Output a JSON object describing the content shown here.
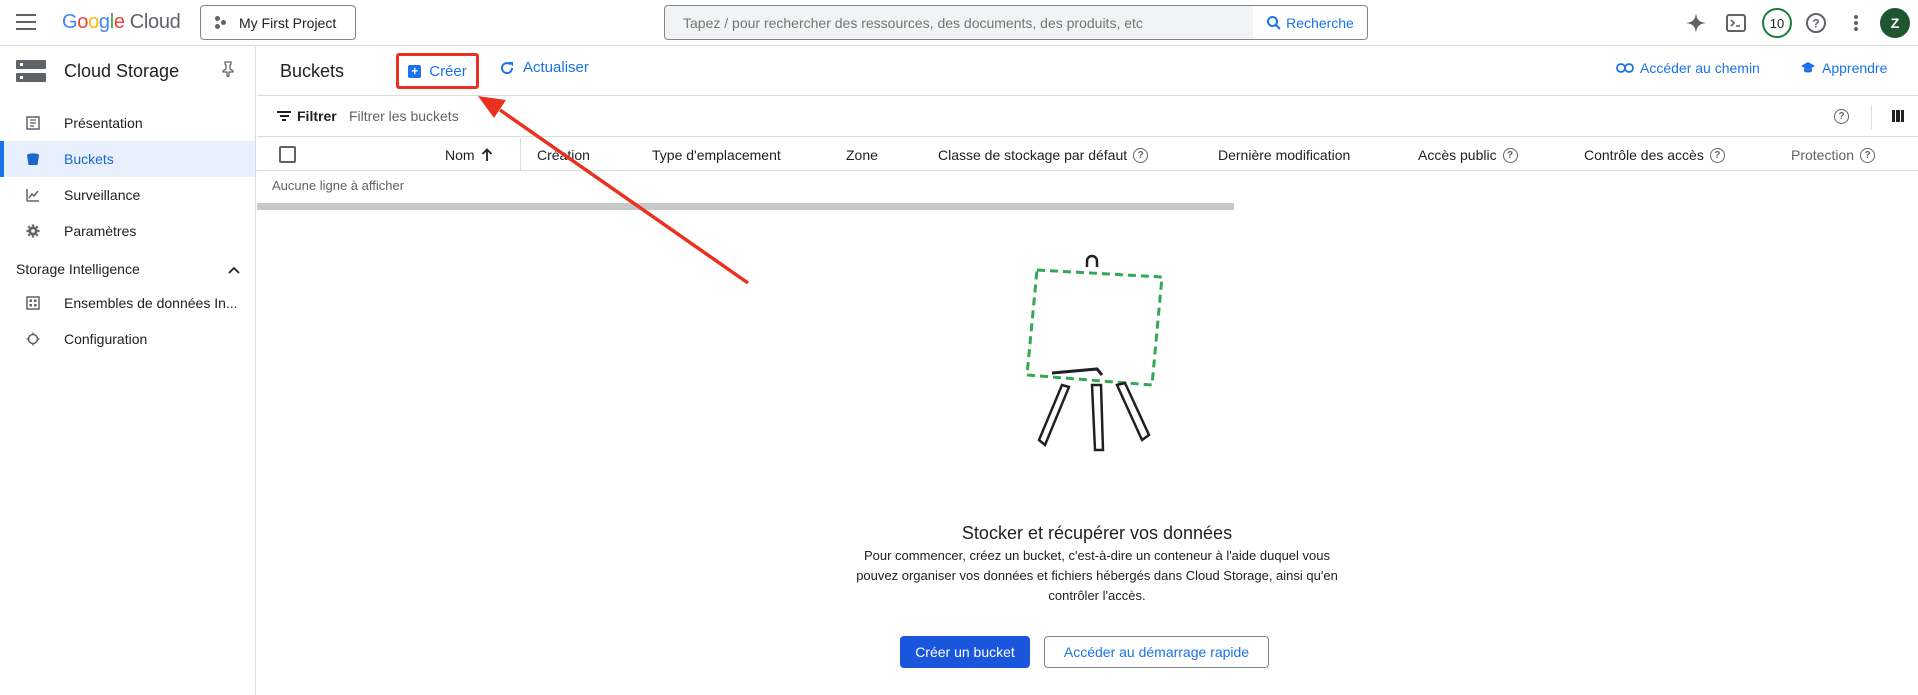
{
  "topbar": {
    "logo_google": "Google",
    "logo_cloud": "Cloud",
    "project": "My First Project",
    "search_placeholder": "Tapez / pour rechercher des ressources, des documents, des produits, etc",
    "search_button": "Recherche",
    "notifications_count": "10",
    "avatar_letter": "Z"
  },
  "sidebar": {
    "title": "Cloud Storage",
    "items": [
      {
        "label": "Présentation",
        "icon": "dashboard-icon"
      },
      {
        "label": "Buckets",
        "icon": "bucket-icon"
      },
      {
        "label": "Surveillance",
        "icon": "chart-icon"
      },
      {
        "label": "Paramètres",
        "icon": "gear-icon"
      }
    ],
    "section_title": "Storage Intelligence",
    "section_items": [
      {
        "label": "Ensembles de données In...",
        "icon": "dataset-icon"
      },
      {
        "label": "Configuration",
        "icon": "config-icon"
      }
    ]
  },
  "toolbar": {
    "title": "Buckets",
    "create": "Créer",
    "refresh": "Actualiser",
    "go_to_path": "Accéder au chemin",
    "learn": "Apprendre"
  },
  "filter": {
    "label": "Filtrer",
    "placeholder": "Filtrer les buckets"
  },
  "table": {
    "columns": [
      "Nom",
      "Création",
      "Type d'emplacement",
      "Zone",
      "Classe de stockage par défaut",
      "Dernière modification",
      "Accès public",
      "Contrôle des accès",
      "Protection"
    ],
    "empty": "Aucune ligne à afficher"
  },
  "empty_state": {
    "title": "Stocker et récupérer vos données",
    "description": "Pour commencer, créez un bucket, c'est-à-dire un conteneur à l'aide duquel vous pouvez organiser vos données et fichiers hébergés dans Cloud Storage, ainsi qu'en contrôler l'accès.",
    "primary": "Créer un bucket",
    "secondary": "Accéder au démarrage rapide"
  },
  "colors": {
    "accent": "#1a73e8",
    "highlight": "#e8321f",
    "illustration": "#34a853"
  }
}
